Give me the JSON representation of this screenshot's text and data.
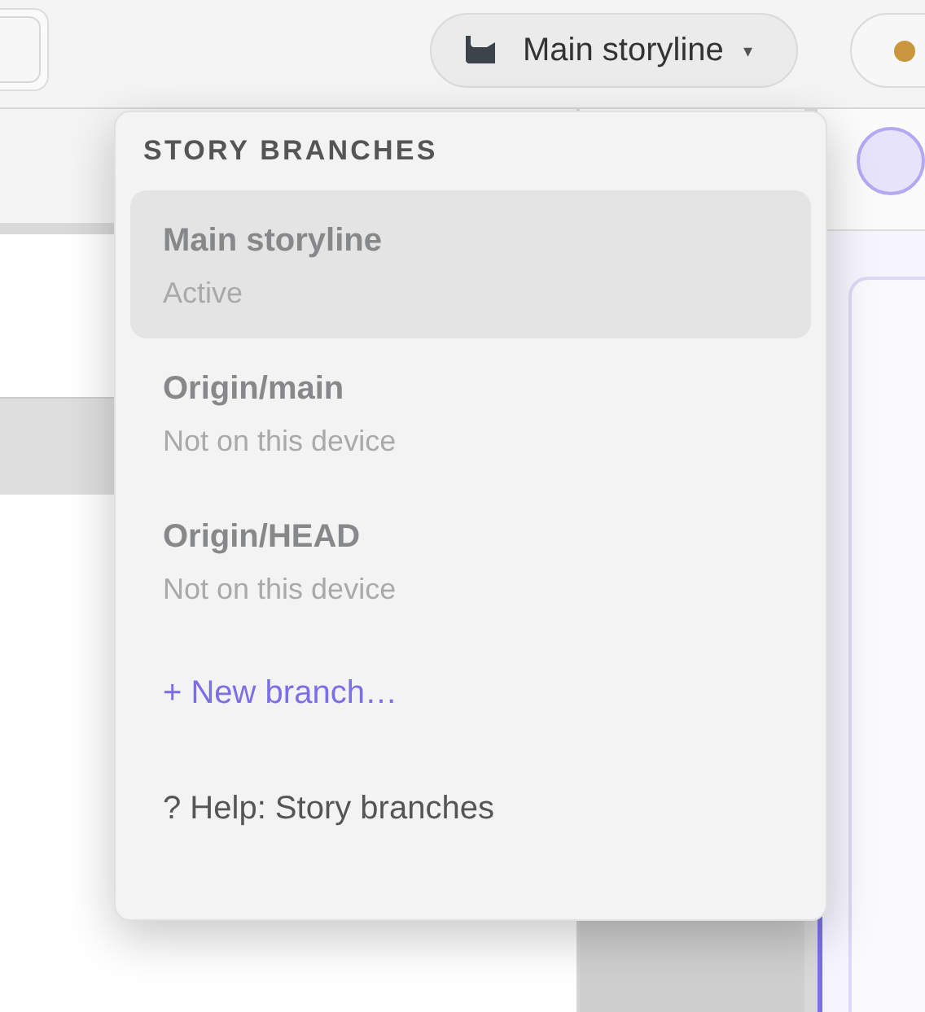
{
  "toolbar": {
    "branch_button": {
      "label": "Main storyline",
      "caret": "▾"
    }
  },
  "branch_menu": {
    "header": "STORY BRANCHES",
    "branches": [
      {
        "name": "Main storyline",
        "status": "Active",
        "selected": true
      },
      {
        "name": "Origin/main",
        "status": "Not on this device",
        "selected": false
      },
      {
        "name": "Origin/HEAD",
        "status": "Not on this device",
        "selected": false
      }
    ],
    "new_branch": "+ New branch…",
    "help": "? Help: Story branches"
  }
}
